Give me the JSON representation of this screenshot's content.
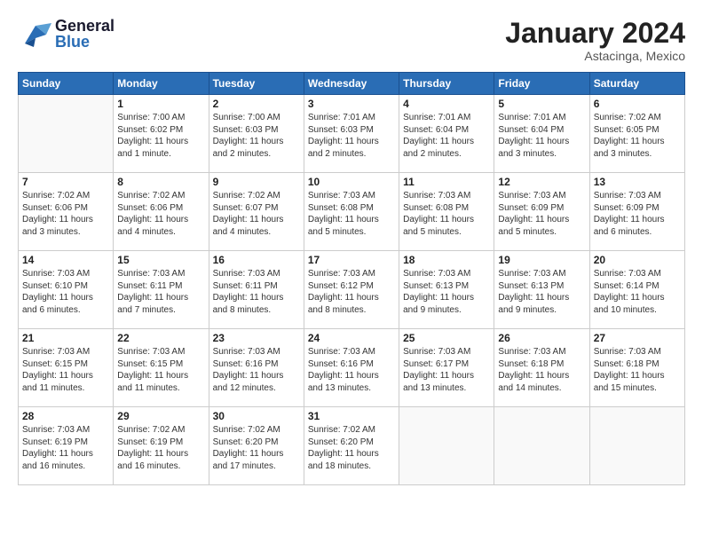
{
  "header": {
    "month_title": "January 2024",
    "location": "Astacinga, Mexico",
    "logo_general": "General",
    "logo_blue": "Blue"
  },
  "days_of_week": [
    "Sunday",
    "Monday",
    "Tuesday",
    "Wednesday",
    "Thursday",
    "Friday",
    "Saturday"
  ],
  "weeks": [
    [
      {
        "day": "",
        "info": ""
      },
      {
        "day": "1",
        "info": "Sunrise: 7:00 AM\nSunset: 6:02 PM\nDaylight: 11 hours\nand 1 minute."
      },
      {
        "day": "2",
        "info": "Sunrise: 7:00 AM\nSunset: 6:03 PM\nDaylight: 11 hours\nand 2 minutes."
      },
      {
        "day": "3",
        "info": "Sunrise: 7:01 AM\nSunset: 6:03 PM\nDaylight: 11 hours\nand 2 minutes."
      },
      {
        "day": "4",
        "info": "Sunrise: 7:01 AM\nSunset: 6:04 PM\nDaylight: 11 hours\nand 2 minutes."
      },
      {
        "day": "5",
        "info": "Sunrise: 7:01 AM\nSunset: 6:04 PM\nDaylight: 11 hours\nand 3 minutes."
      },
      {
        "day": "6",
        "info": "Sunrise: 7:02 AM\nSunset: 6:05 PM\nDaylight: 11 hours\nand 3 minutes."
      }
    ],
    [
      {
        "day": "7",
        "info": "Sunrise: 7:02 AM\nSunset: 6:06 PM\nDaylight: 11 hours\nand 3 minutes."
      },
      {
        "day": "8",
        "info": "Sunrise: 7:02 AM\nSunset: 6:06 PM\nDaylight: 11 hours\nand 4 minutes."
      },
      {
        "day": "9",
        "info": "Sunrise: 7:02 AM\nSunset: 6:07 PM\nDaylight: 11 hours\nand 4 minutes."
      },
      {
        "day": "10",
        "info": "Sunrise: 7:03 AM\nSunset: 6:08 PM\nDaylight: 11 hours\nand 5 minutes."
      },
      {
        "day": "11",
        "info": "Sunrise: 7:03 AM\nSunset: 6:08 PM\nDaylight: 11 hours\nand 5 minutes."
      },
      {
        "day": "12",
        "info": "Sunrise: 7:03 AM\nSunset: 6:09 PM\nDaylight: 11 hours\nand 5 minutes."
      },
      {
        "day": "13",
        "info": "Sunrise: 7:03 AM\nSunset: 6:09 PM\nDaylight: 11 hours\nand 6 minutes."
      }
    ],
    [
      {
        "day": "14",
        "info": "Sunrise: 7:03 AM\nSunset: 6:10 PM\nDaylight: 11 hours\nand 6 minutes."
      },
      {
        "day": "15",
        "info": "Sunrise: 7:03 AM\nSunset: 6:11 PM\nDaylight: 11 hours\nand 7 minutes."
      },
      {
        "day": "16",
        "info": "Sunrise: 7:03 AM\nSunset: 6:11 PM\nDaylight: 11 hours\nand 8 minutes."
      },
      {
        "day": "17",
        "info": "Sunrise: 7:03 AM\nSunset: 6:12 PM\nDaylight: 11 hours\nand 8 minutes."
      },
      {
        "day": "18",
        "info": "Sunrise: 7:03 AM\nSunset: 6:13 PM\nDaylight: 11 hours\nand 9 minutes."
      },
      {
        "day": "19",
        "info": "Sunrise: 7:03 AM\nSunset: 6:13 PM\nDaylight: 11 hours\nand 9 minutes."
      },
      {
        "day": "20",
        "info": "Sunrise: 7:03 AM\nSunset: 6:14 PM\nDaylight: 11 hours\nand 10 minutes."
      }
    ],
    [
      {
        "day": "21",
        "info": "Sunrise: 7:03 AM\nSunset: 6:15 PM\nDaylight: 11 hours\nand 11 minutes."
      },
      {
        "day": "22",
        "info": "Sunrise: 7:03 AM\nSunset: 6:15 PM\nDaylight: 11 hours\nand 11 minutes."
      },
      {
        "day": "23",
        "info": "Sunrise: 7:03 AM\nSunset: 6:16 PM\nDaylight: 11 hours\nand 12 minutes."
      },
      {
        "day": "24",
        "info": "Sunrise: 7:03 AM\nSunset: 6:16 PM\nDaylight: 11 hours\nand 13 minutes."
      },
      {
        "day": "25",
        "info": "Sunrise: 7:03 AM\nSunset: 6:17 PM\nDaylight: 11 hours\nand 13 minutes."
      },
      {
        "day": "26",
        "info": "Sunrise: 7:03 AM\nSunset: 6:18 PM\nDaylight: 11 hours\nand 14 minutes."
      },
      {
        "day": "27",
        "info": "Sunrise: 7:03 AM\nSunset: 6:18 PM\nDaylight: 11 hours\nand 15 minutes."
      }
    ],
    [
      {
        "day": "28",
        "info": "Sunrise: 7:03 AM\nSunset: 6:19 PM\nDaylight: 11 hours\nand 16 minutes."
      },
      {
        "day": "29",
        "info": "Sunrise: 7:02 AM\nSunset: 6:19 PM\nDaylight: 11 hours\nand 16 minutes."
      },
      {
        "day": "30",
        "info": "Sunrise: 7:02 AM\nSunset: 6:20 PM\nDaylight: 11 hours\nand 17 minutes."
      },
      {
        "day": "31",
        "info": "Sunrise: 7:02 AM\nSunset: 6:20 PM\nDaylight: 11 hours\nand 18 minutes."
      },
      {
        "day": "",
        "info": ""
      },
      {
        "day": "",
        "info": ""
      },
      {
        "day": "",
        "info": ""
      }
    ]
  ]
}
